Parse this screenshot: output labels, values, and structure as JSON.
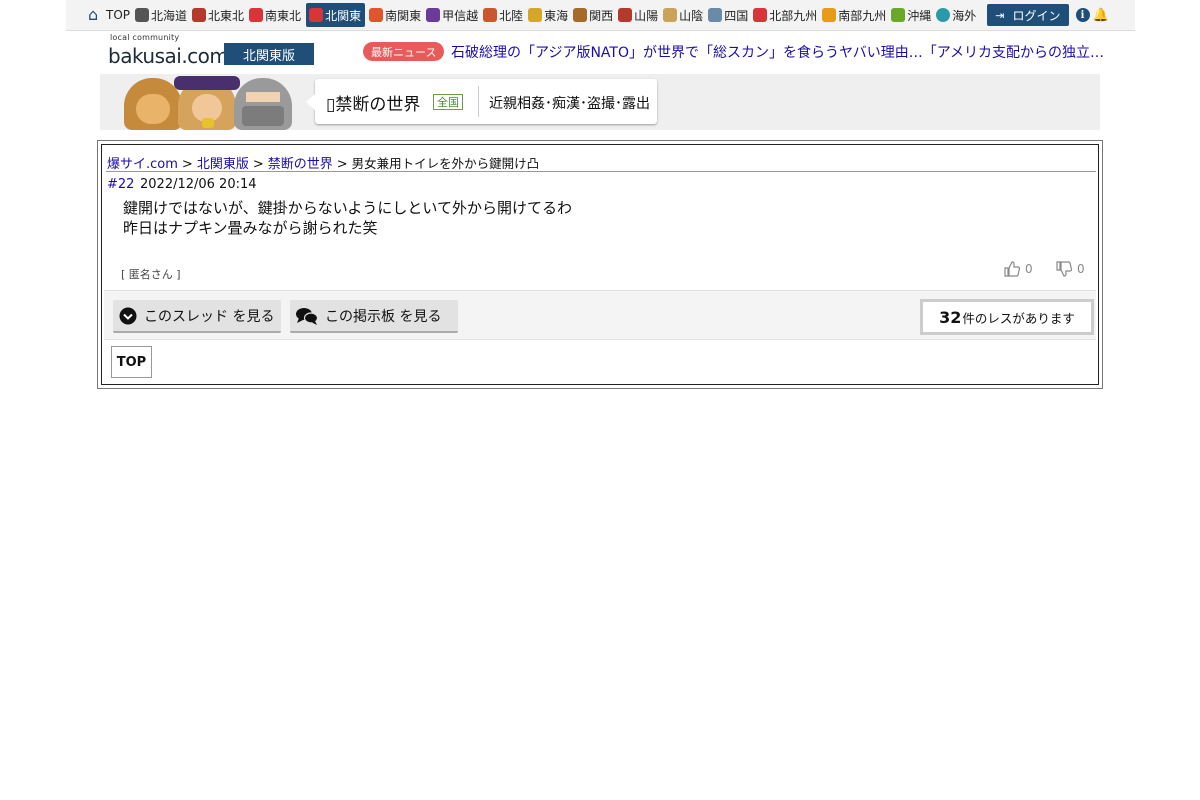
{
  "nav": {
    "items": [
      {
        "label": "TOP",
        "icon": "home-icon",
        "color": "#1f4e79"
      },
      {
        "label": "北海道",
        "icon": "cow-icon",
        "color": "#555555"
      },
      {
        "label": "北東北",
        "icon": "namahage-icon",
        "color": "#b33a2a"
      },
      {
        "label": "南東北",
        "icon": "cherry-icon",
        "color": "#d8343a"
      },
      {
        "label": "北関東",
        "icon": "daruma-icon",
        "color": "#d8343a"
      },
      {
        "label": "南関東",
        "icon": "tower-icon",
        "color": "#e0542e"
      },
      {
        "label": "甲信越",
        "icon": "grape-icon",
        "color": "#6a3b9a"
      },
      {
        "label": "北陸",
        "icon": "torii-icon",
        "color": "#c9572d"
      },
      {
        "label": "東海",
        "icon": "shachihoko-icon",
        "color": "#d4a62a"
      },
      {
        "label": "関西",
        "icon": "takoyaki-icon",
        "color": "#a66a2a"
      },
      {
        "label": "山陽",
        "icon": "castle-icon",
        "color": "#b33a2a"
      },
      {
        "label": "山陰",
        "icon": "dune-icon",
        "color": "#c9a35a"
      },
      {
        "label": "四国",
        "icon": "udon-icon",
        "color": "#6a8aa8"
      },
      {
        "label": "北部九州",
        "icon": "mentaiko-icon",
        "color": "#d8343a"
      },
      {
        "label": "南部九州",
        "icon": "mango-icon",
        "color": "#e89a1a"
      },
      {
        "label": "沖縄",
        "icon": "goya-icon",
        "color": "#6aa82a"
      },
      {
        "label": "海外",
        "icon": "globe-icon",
        "color": "#2a9aa8"
      }
    ],
    "active_index": 4,
    "login_label": "ログイン"
  },
  "header": {
    "logo_tagline": "local community",
    "logo_text": "bakusai.com",
    "region": "北関東版",
    "news_badge": "最新ニュース",
    "news_headline": "石破総理の「アジア版NATO」が世界で「総スカン」を食らうヤバい理由…「アメリカ支配からの独立」を口..."
  },
  "banner": {
    "board_title": "禁断の世界",
    "scope": "全国",
    "description": "近親相姦･痴漢･盗撮･露出"
  },
  "breadcrumb": {
    "home": "爆サイ.com",
    "region": "北関東版",
    "board": "禁断の世界",
    "thread": "男女兼用トイレを外から鍵開け凸",
    "separator": ">"
  },
  "post": {
    "number": "#22",
    "date": "2022/12/06 20:14",
    "lines": [
      "鍵開けではないが、鍵掛からないようにしといて外から開けてるわ",
      "昨日はナプキン畳みながら謝られた笑"
    ],
    "author": "[ 匿名さん ]",
    "likes": "0",
    "dislikes": "0"
  },
  "actions": {
    "thread_button": "このスレッド を見る",
    "board_button": "この掲示板 を見る",
    "res_count": "32",
    "res_suffix": "件のレスがあります",
    "top_button": "TOP"
  },
  "colors": {
    "accent": "#1f4e79",
    "link": "#1a0dab",
    "news_badge": "#e85b5b"
  }
}
